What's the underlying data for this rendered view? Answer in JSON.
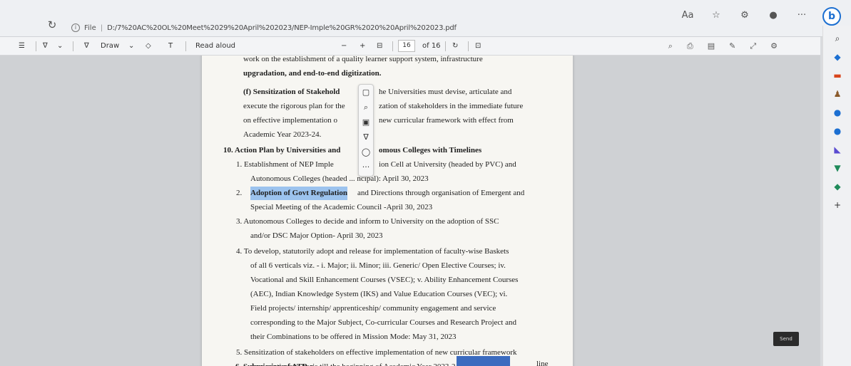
{
  "browser": {
    "file_label": "File",
    "url": "D:/7%20AC%20OL%20Meet%2029%20April%202023/NEP-Imple%20GR%2020%20April%202023.pdf",
    "profile_initial": "b"
  },
  "toolbar": {
    "draw_label": "Draw",
    "read_aloud_label": "Read aloud",
    "minus": "−",
    "plus": "+",
    "page_current": "16",
    "page_total": "of 16"
  },
  "document": {
    "lines": [
      "work on the establishment of a quality learner support system, infrastructure",
      "upgradation, and end-to-end digitization.",
      "(f) Sensitization of Stakehold",
      "he Universities must devise, articulate and",
      "execute the rigorous plan for the",
      "zation of stakeholders in the immediate future",
      "on effective implementation o",
      "new curricular framework with effect from",
      "Academic Year 2023-24.",
      "10. Action Plan by Universities and",
      "omous Colleges with Timelines",
      "1.  Establishment of NEP Imple",
      "ion Cell at University (headed by PVC) and",
      "Autonomous Colleges (headed ... ncipal): April 30, 2023",
      "2.",
      "Adoption of Govt Regulation",
      "and Directions through organisation of Emergent and",
      "Special Meeting of the Academic Council -April 30, 2023",
      "3.  Autonomous Colleges to decide and inform to University on the adoption of SSC",
      "and/or DSC Major Option- April 30, 2023",
      "4.  To develop, statutorily adopt and release for implementation of faculty-wise Baskets",
      "of all 6 verticals viz. - i. Major; ii. Minor; iii. Generic/ Open Elective Courses; iv.",
      "Vocational and Skill Enhancement Courses (VSEC); v. Ability Enhancement Courses",
      "(AEC), Indian Knowledge System (IKS) and Value Education Courses (VEC); vi.",
      "Field projects/ internship/ apprenticeship/ community engagement and service",
      "corresponding to the Major Subject, Co-curricular Courses and Research Project and",
      "their Combinations to be offered in Mission Mode: May 31, 2023",
      "5.  Sensitization of stakeholders on effective implementation of new curricular framework",
      "on a continuous basis till the beginning of Academic Year 2023-24",
      "6.  Submission of ATR o",
      "line"
    ]
  },
  "send_label": "Send",
  "colors": {
    "accent": "#1c6fd1",
    "highlight": "#9cc3ee"
  }
}
